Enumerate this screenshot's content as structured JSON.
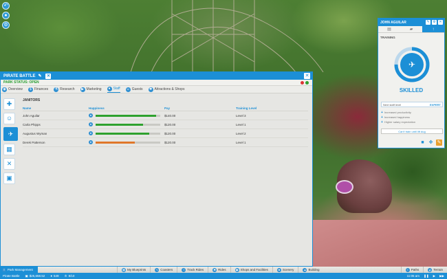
{
  "window": {
    "park_name": "PIRATE BATTLE",
    "status_text": "PARK STATUS: OPEN",
    "tabs": [
      {
        "label": "Overview",
        "icon": "eye-icon"
      },
      {
        "label": "Finances",
        "icon": "dollar-icon"
      },
      {
        "label": "Research",
        "icon": "flask-icon"
      },
      {
        "label": "Marketing",
        "icon": "megaphone-icon"
      },
      {
        "label": "Staff",
        "icon": "person-icon",
        "active": true
      },
      {
        "label": "Guests",
        "icon": "guests-icon"
      },
      {
        "label": "Attractions & Shops",
        "icon": "attractions-icon"
      }
    ],
    "rail_icons": [
      "hire-staff-icon",
      "entertainer-icon",
      "janitor-icon",
      "vendor-icon",
      "mechanic-icon",
      "security-icon"
    ],
    "section_title": "JANITORS",
    "columns": {
      "name": "Name",
      "happiness": "Happiness",
      "pay": "Pay",
      "training": "Training Level"
    },
    "rows": [
      {
        "name": "John Aguilar",
        "happiness": 0.94,
        "bar_color": "#2ea12e",
        "pay": "$140.00",
        "training": "Level 3"
      },
      {
        "name": "Carla Phipps",
        "happiness": 0.73,
        "bar_color": "#2ea12e",
        "pay": "$120.00",
        "training": "Level 1"
      },
      {
        "name": "Augustus Wyman",
        "happiness": 0.83,
        "bar_color": "#2ea12e",
        "pay": "$120.00",
        "training": "Level 2"
      },
      {
        "name": "Derek Patterson",
        "happiness": 0.61,
        "bar_color": "#e0772a",
        "pay": "$120.00",
        "training": "Level 1"
      }
    ]
  },
  "panel": {
    "title": "JOHN AGUILAR",
    "tabs": [
      "clipboard-icon",
      "briefcase-icon",
      "training-arrow-icon"
    ],
    "section": "TRAINING",
    "skill_label": "SKILLED",
    "skill_progress": 0.75,
    "next_level_label": "Next staff level",
    "next_level_value": "EXPERT",
    "benefits": [
      "Increased productivity",
      "Increased happiness",
      "Higher salary expectation"
    ],
    "cant_train_text": "Can't train until lift dug",
    "accent": "#1c8fd6"
  },
  "bottom_bar": {
    "park_management": "Park Management",
    "items": [
      "My Blueprints",
      "Coasters",
      "Track Rides",
      "Rides",
      "Shops and Facilities",
      "Scenery",
      "Building",
      "Paths",
      "Terrain"
    ]
  },
  "status_strip": {
    "park": "Pirate Battle",
    "money": "$25,658.52",
    "guests": "549",
    "rating": "8/10",
    "time": "11:05 am"
  }
}
